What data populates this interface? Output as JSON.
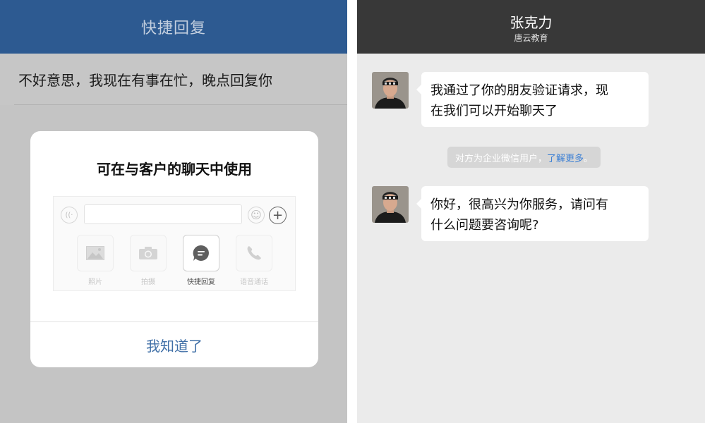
{
  "left_panel": {
    "header_title": "快捷回复",
    "reply_item": "不好意思，我现在有事在忙，晚点回复你",
    "dialog": {
      "title": "可在与客户的聊天中使用",
      "toolbar_items": [
        {
          "label": "照片",
          "icon": "photo-icon"
        },
        {
          "label": "拍摄",
          "icon": "camera-icon"
        },
        {
          "label": "快捷回复",
          "icon": "quick-reply-icon"
        },
        {
          "label": "语音通话",
          "icon": "phone-icon"
        }
      ],
      "confirm_button": "我知道了"
    }
  },
  "right_panel": {
    "contact_name": "张克力",
    "contact_org": "唐云教育",
    "messages": [
      {
        "text_line1": "我通过了你的朋友验证请求，现",
        "text_line2": "在我们可以开始聊天了"
      },
      {
        "text_line1": "你好，很高兴为你服务，请问有",
        "text_line2": "什么问题要咨询呢?"
      }
    ],
    "system_notice": {
      "text": "对方为企业微信用户，",
      "link": "了解更多",
      "suffix": "。"
    }
  },
  "colors": {
    "header_blue": "#2d5a91",
    "header_dark": "#383838",
    "link_blue": "#3a7fd5",
    "button_blue": "#3e6ea6"
  }
}
